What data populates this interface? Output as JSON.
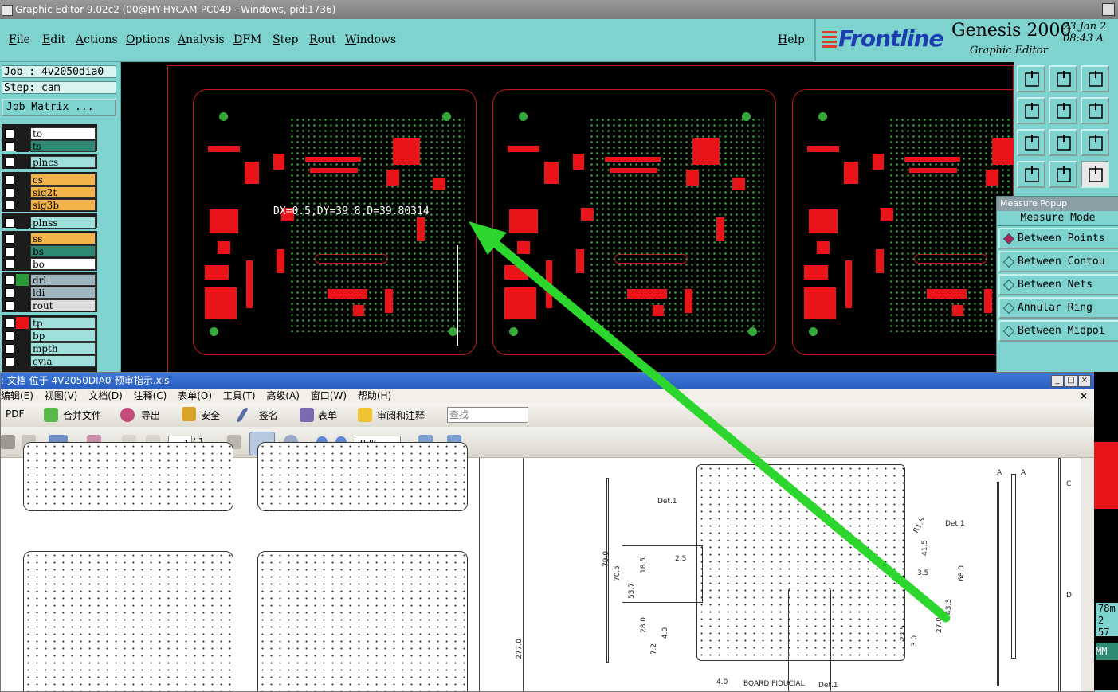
{
  "window": {
    "title": "Graphic Editor 9.02c2 (00@HY-HYCAM-PC049 - Windows, pid:1736)"
  },
  "menu": {
    "items": [
      "File",
      "Edit",
      "Actions",
      "Options",
      "Analysis",
      "DFM",
      "Step",
      "Rout",
      "Windows"
    ],
    "help": "Help"
  },
  "brand": {
    "logo": "Frontline",
    "product": "Genesis 2000",
    "subtitle": "Graphic Editor",
    "date_line1": "23 Jan 2",
    "date_line2": "08:43 A"
  },
  "job": {
    "job_label": "Job : 4v2050dia0",
    "step_label": "Step: cam",
    "matrix_button": "Job Matrix ..."
  },
  "layers": [
    {
      "name": "to",
      "color": "#ffffff"
    },
    {
      "name": "ts",
      "color": "#2e8a74"
    },
    {
      "name": "plncs",
      "color": "#9fe0dc"
    },
    {
      "name": "cs",
      "color": "#f2b44a"
    },
    {
      "name": "sig2t",
      "color": "#f2b44a"
    },
    {
      "name": "sig3b",
      "color": "#f2b44a"
    },
    {
      "name": "plnss",
      "color": "#9fe0dc"
    },
    {
      "name": "ss",
      "color": "#f2b44a"
    },
    {
      "name": "bs",
      "color": "#2e8a74"
    },
    {
      "name": "bo",
      "color": "#ffffff"
    },
    {
      "name": "drl",
      "color": "#9fb5bf"
    },
    {
      "name": "ldi",
      "color": "#9fb5bf"
    },
    {
      "name": "rout",
      "color": "#dddddd"
    },
    {
      "name": "tp",
      "color": "#9fe0dc"
    },
    {
      "name": "bp",
      "color": "#9fe0dc"
    },
    {
      "name": "mpth",
      "color": "#9fe0dc"
    },
    {
      "name": "cvia",
      "color": "#9fe0dc"
    }
  ],
  "canvas": {
    "measurement": "DX=0.5,DY=39.8,D=39.80314",
    "pad_color": "#e8141a",
    "outline_color": "#c0161c",
    "arrow_color": "#2cd62c"
  },
  "measure_popup": {
    "title": "Measure Popup",
    "mode_label": "Measure Mode",
    "options": [
      "Between Points",
      "Between Contou",
      "Between Nets",
      "Annular Ring",
      "Between Midpoi"
    ],
    "selected": "Between Points"
  },
  "tools": [
    "zoom-home-icon",
    "zoom-in-icon",
    "pan-icon",
    "move-left-icon",
    "move-right-icon",
    "snap-icon",
    "fit-icon",
    "center-icon",
    "scale-1-2-icon",
    "settings-icon",
    "key-icon",
    "measure-icon"
  ],
  "pdf": {
    "title": ": 文档 位于 4V2050DIA0-预审指示.xls",
    "menu": [
      "编辑(E)",
      "视图(V)",
      "文档(D)",
      "注释(C)",
      "表单(O)",
      "工具(T)",
      "高级(A)",
      "窗口(W)",
      "帮助(H)"
    ],
    "toolbar1": [
      "PDF",
      "合并文件",
      "导出",
      "安全",
      "签名",
      "表单",
      "审阅和注释"
    ],
    "search_placeholder": "查找",
    "page_current": "1",
    "page_total": "/ 1",
    "zoom": "75%",
    "drawing_labels": [
      "Det.1",
      "Det.1",
      "R1.5",
      "2.5",
      "3.5",
      "79.0",
      "70.5",
      "53.7",
      "18.5",
      "28.0",
      "41.5",
      "68.0",
      "43.3",
      "27.0",
      "22.5",
      "3.0",
      "4.0",
      "7.2",
      "277.0",
      "4.0",
      "BOARD FIDUCIAL",
      "Det.1",
      "A",
      "A",
      "C",
      "D"
    ]
  },
  "right_strip": {
    "values": [
      "78m",
      "2 57",
      "MM"
    ]
  }
}
